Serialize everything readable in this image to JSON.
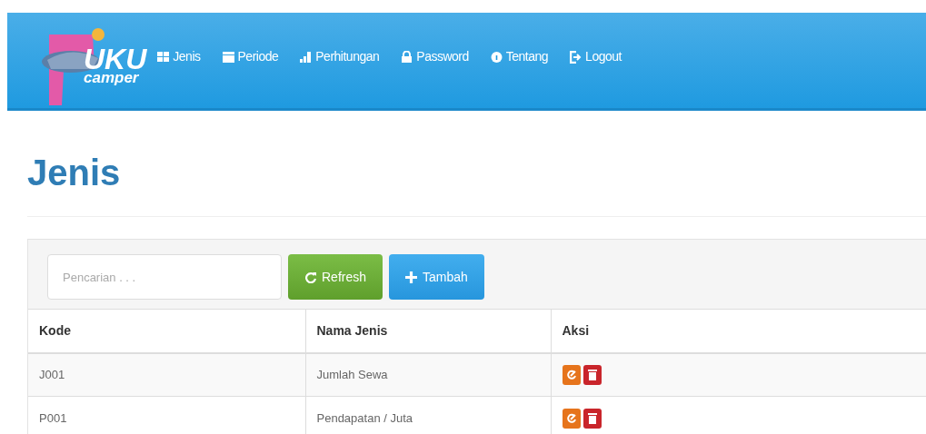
{
  "logo": {
    "title": "UKU",
    "subtitle": "camper"
  },
  "nav": [
    {
      "label": "Jenis"
    },
    {
      "label": "Periode"
    },
    {
      "label": "Perhitungan"
    },
    {
      "label": "Password"
    },
    {
      "label": "Tentang"
    },
    {
      "label": "Logout"
    }
  ],
  "page_title": "Jenis",
  "toolbar": {
    "search": {
      "placeholder": "Pencarian . . ."
    },
    "buttons": [
      {
        "label": "Refresh",
        "kind": "refresh"
      },
      {
        "label": "Tambah",
        "kind": "add"
      }
    ]
  },
  "table": {
    "columns": [
      "Kode",
      "Nama Jenis",
      "Aksi"
    ],
    "rows": [
      {
        "cells": [
          "J001",
          "Jumlah Sewa"
        ]
      },
      {
        "cells": [
          "P001",
          "Pendapatan / Juta"
        ]
      }
    ]
  }
}
